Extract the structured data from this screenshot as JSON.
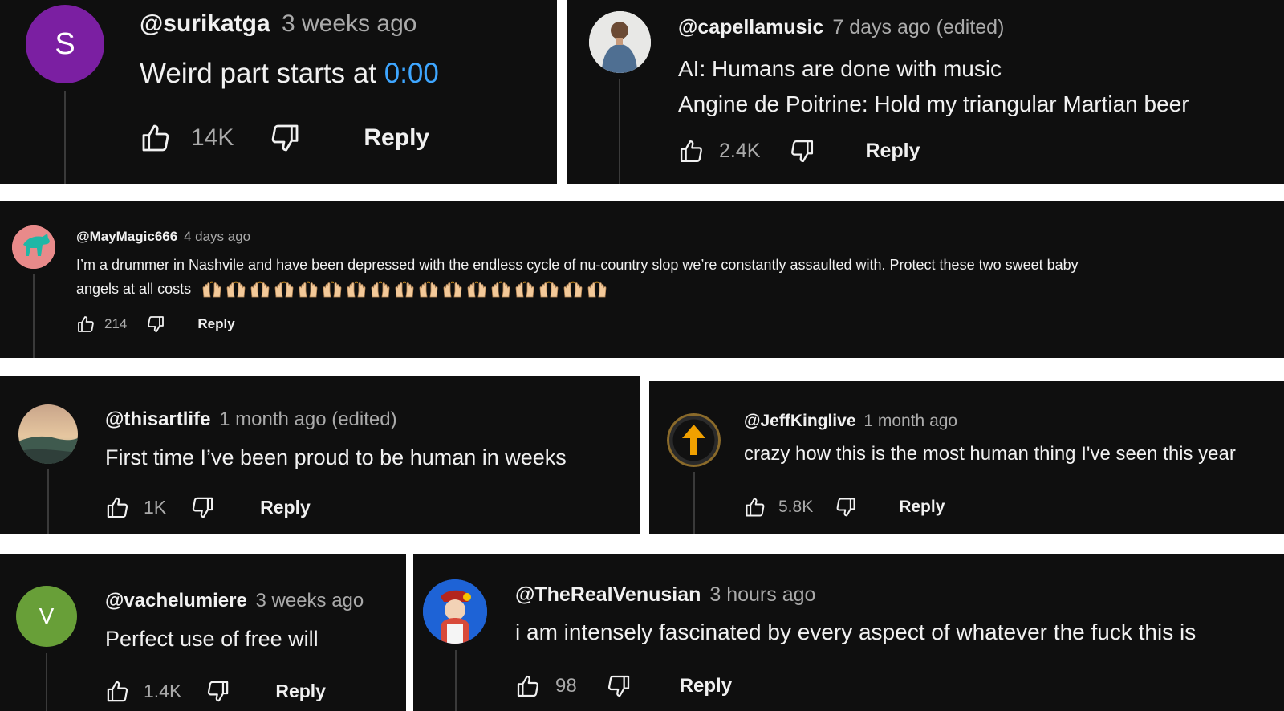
{
  "comments": [
    {
      "id": "c1",
      "username": "@surikatga",
      "time": "3 weeks ago",
      "text_prefix": "Weird part starts at ",
      "timestamp_link": "0:00",
      "likes": "14K",
      "reply": "Reply",
      "avatar": {
        "letter": "S",
        "color": "#7b1fa2"
      }
    },
    {
      "id": "c2",
      "username": "@capellamusic",
      "time": "7 days ago (edited)",
      "lines": [
        "AI: Humans are done with music",
        "Angine de Poitrine: Hold my triangular Martian beer"
      ],
      "likes": "2.4K",
      "reply": "Reply",
      "avatar": {
        "icon": "person-photo-avatar"
      }
    },
    {
      "id": "c3",
      "username": "@MayMagic666",
      "time": "4 days ago",
      "lines": [
        "I’m a drummer in Nashvile and have been depressed with the endless cycle of nu-country slop we’re constantly assaulted with. Protect these two sweet baby",
        "angels at all costs"
      ],
      "emoji": {
        "icon": "raising-hands-emoji",
        "count": 17
      },
      "likes": "214",
      "reply": "Reply",
      "avatar": {
        "icon": "teal-horse-avatar",
        "color": "#e88a8a"
      }
    },
    {
      "id": "c4",
      "username": "@thisartlife",
      "time": "1 month ago (edited)",
      "lines": [
        "First time I’ve been proud to be human in weeks"
      ],
      "likes": "1K",
      "reply": "Reply",
      "avatar": {
        "icon": "landscape-photo-avatar"
      }
    },
    {
      "id": "c5",
      "username": "@JeffKinglive",
      "time": "1 month ago",
      "lines": [
        "crazy how this is the most human thing I've seen this year"
      ],
      "likes": "5.8K",
      "reply": "Reply",
      "avatar": {
        "icon": "up-arrow-avatar",
        "color": "#f0a000"
      }
    },
    {
      "id": "c6",
      "username": "@vachelumiere",
      "time": "3 weeks ago",
      "lines": [
        "Perfect use of free will"
      ],
      "likes": "1.4K",
      "reply": "Reply",
      "avatar": {
        "letter": "V",
        "color": "#689f38"
      }
    },
    {
      "id": "c7",
      "username": "@TheRealVenusian",
      "time": "3 hours ago",
      "lines": [
        "i am intensely fascinated by every aspect of whatever the fuck this is"
      ],
      "likes": "98",
      "reply": "Reply",
      "avatar": {
        "icon": "cartoon-character-avatar",
        "color": "#1e63d6"
      }
    }
  ],
  "icons": {
    "like": "thumbs-up-icon",
    "dislike": "thumbs-down-icon"
  }
}
